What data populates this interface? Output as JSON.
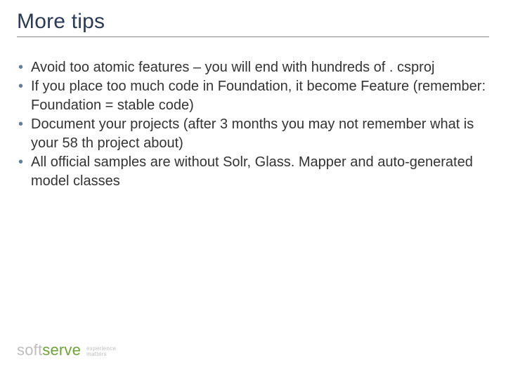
{
  "title": "More tips",
  "bullets": [
    "Avoid too atomic features – you will end with hundreds of . csproj",
    "If you place too much code in Foundation, it become Feature (remember: Foundation = stable code)",
    "Document your projects (after 3 months you may not remember what is your 58 th project about)",
    "All official samples are without Solr, Glass. Mapper and auto-generated model classes"
  ],
  "footer": {
    "brand_soft": "soft",
    "brand_serve": "serve",
    "tagline_1": "experience",
    "tagline_2": "matters"
  }
}
